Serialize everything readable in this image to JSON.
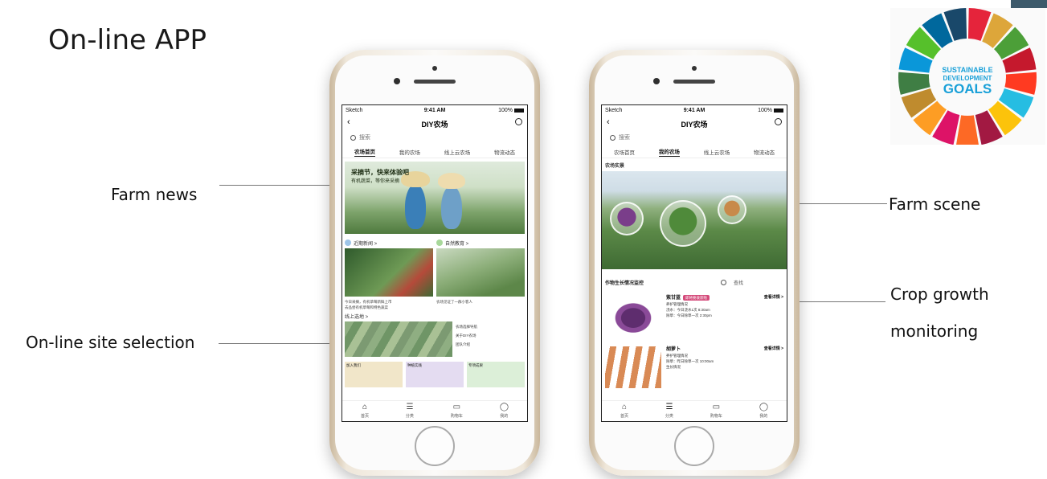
{
  "slide": {
    "title": "On-line APP",
    "callouts": {
      "farm_news": "Farm news",
      "online_site_selection": "On-line site selection",
      "farm_scene": "Farm scene",
      "crop_growth_line1": "Crop growth",
      "crop_growth_line2": "monitoring"
    }
  },
  "sdg": {
    "line1": "SUSTAINABLE",
    "line2": "DEVELOPMENT",
    "line3": "GOALS"
  },
  "phone_left": {
    "status": {
      "carrier": "Sketch",
      "time": "9:41 AM",
      "battery": "100%"
    },
    "nav_title": "DIY农场",
    "search_placeholder": "搜索",
    "tabs": [
      "农场首页",
      "我的农场",
      "线上云农场",
      "物流动态"
    ],
    "active_tab": 0,
    "hero": {
      "headline": "采摘节，快来体验吧",
      "subline": "有机蔬菜，等你来采摘"
    },
    "section_news": "近期新闻 >",
    "section_edu": "自然教育 >",
    "news_caption_1": "今日采摘，有机草莓新鲜上市",
    "news_caption_2": "去品尝有机草莓和特色蔬菜",
    "edu_caption": "农场见证了一群小客人",
    "site_head": "线上选地 >",
    "site_list": [
      "农场选择导航",
      "关于DIY农场",
      "团队介绍"
    ],
    "cards": [
      "加入我们",
      "种植实践",
      "专项成果"
    ],
    "tabbar": [
      {
        "icon": "home-icon",
        "label": "首页"
      },
      {
        "icon": "list-icon",
        "label": "分类"
      },
      {
        "icon": "cart-icon",
        "label": "购物车"
      },
      {
        "icon": "user-icon",
        "label": "我的"
      }
    ]
  },
  "phone_right": {
    "status": {
      "carrier": "Sketch",
      "time": "9:41 AM",
      "battery": "100%"
    },
    "nav_title": "DIY农场",
    "search_placeholder": "搜索",
    "tabs": [
      "农场首页",
      "我的农场",
      "线上云农场",
      "物流动态"
    ],
    "active_tab": 1,
    "scene_head": "农场实景",
    "monitor_head": "作物生长情况监控",
    "monitor_search": "查找",
    "crops": [
      {
        "name": "紫甘蓝",
        "tag": "即将要收获啦",
        "detail": "查看详情 >",
        "line1": "养护管理情况",
        "line2": "浇水：今日浇水1次 8:30am",
        "line3": "除草：今日除草一次 2:30pm"
      },
      {
        "name": "胡萝卜",
        "tag": "",
        "detail": "查看详情 >",
        "line1": "养护管理情况",
        "line2": "除草：昨日除草一次 10:00am",
        "line3": "生长情况"
      }
    ],
    "tabbar": [
      {
        "icon": "home-icon",
        "label": "首页"
      },
      {
        "icon": "list-icon",
        "label": "分类"
      },
      {
        "icon": "cart-icon",
        "label": "购物车"
      },
      {
        "icon": "user-icon",
        "label": "我的"
      }
    ]
  }
}
